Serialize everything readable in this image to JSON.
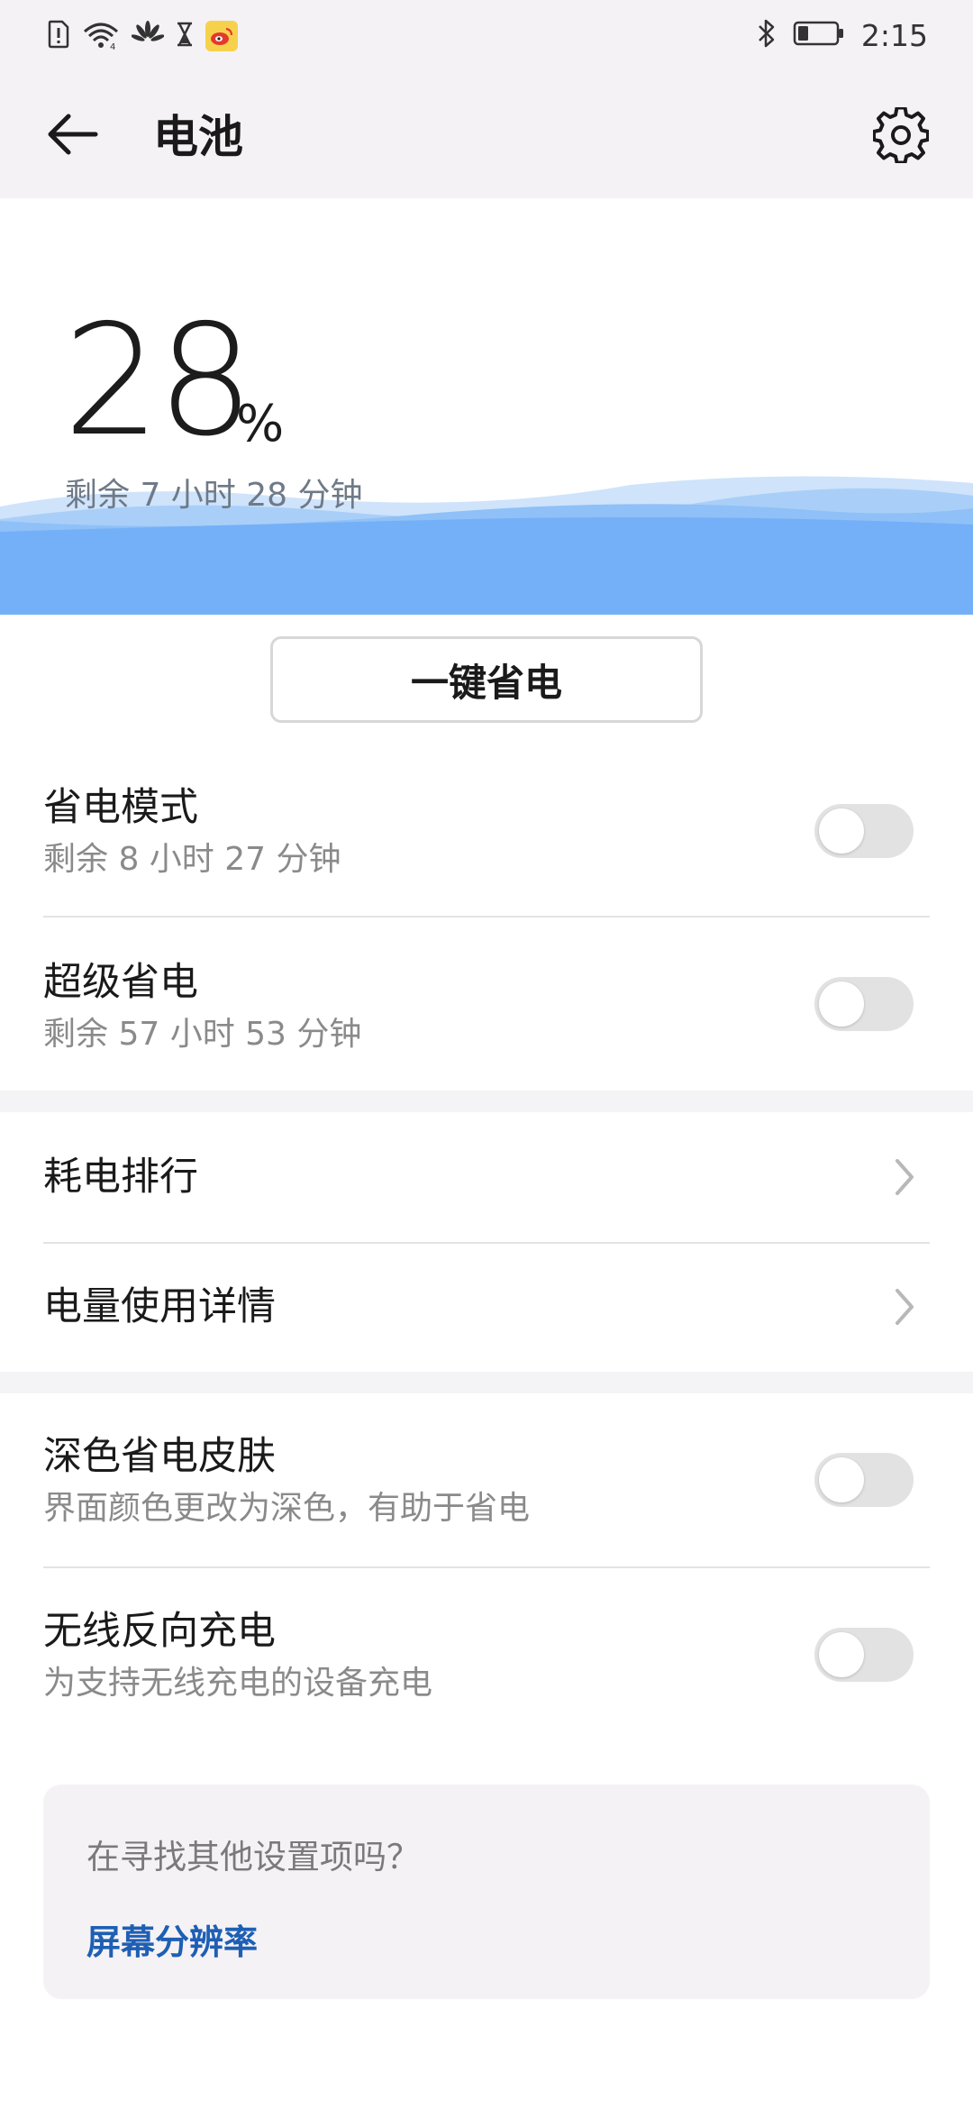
{
  "status_bar": {
    "time": "2:15",
    "icons": [
      "sim-alert-icon",
      "wifi-icon",
      "huawei-icon",
      "hourglass-icon",
      "weibo-icon",
      "bluetooth-icon",
      "battery-icon"
    ],
    "battery_level": 0.28
  },
  "app_bar": {
    "title": "电池",
    "back_icon": "arrow-left-icon",
    "settings_icon": "gear-icon"
  },
  "hero": {
    "percent": "28",
    "percent_sign": "%",
    "remaining": "剩余 7 小时 28 分钟",
    "wave_color": "#6aaef7"
  },
  "save_button": {
    "label": "一键省电"
  },
  "power_modes": [
    {
      "title": "省电模式",
      "subtitle": "剩余 8 小时 27 分钟",
      "enabled": false
    },
    {
      "title": "超级省电",
      "subtitle": "剩余 57 小时 53 分钟",
      "enabled": false
    }
  ],
  "links": [
    {
      "title": "耗电排行"
    },
    {
      "title": "电量使用详情"
    }
  ],
  "extra_options": [
    {
      "title": "深色省电皮肤",
      "subtitle": "界面颜色更改为深色，有助于省电",
      "enabled": false
    },
    {
      "title": "无线反向充电",
      "subtitle": "为支持无线充电的设备充电",
      "enabled": false
    }
  ],
  "suggestion": {
    "question": "在寻找其他设置项吗？",
    "link": "屏幕分辨率",
    "link_color": "#1e5fb4"
  }
}
